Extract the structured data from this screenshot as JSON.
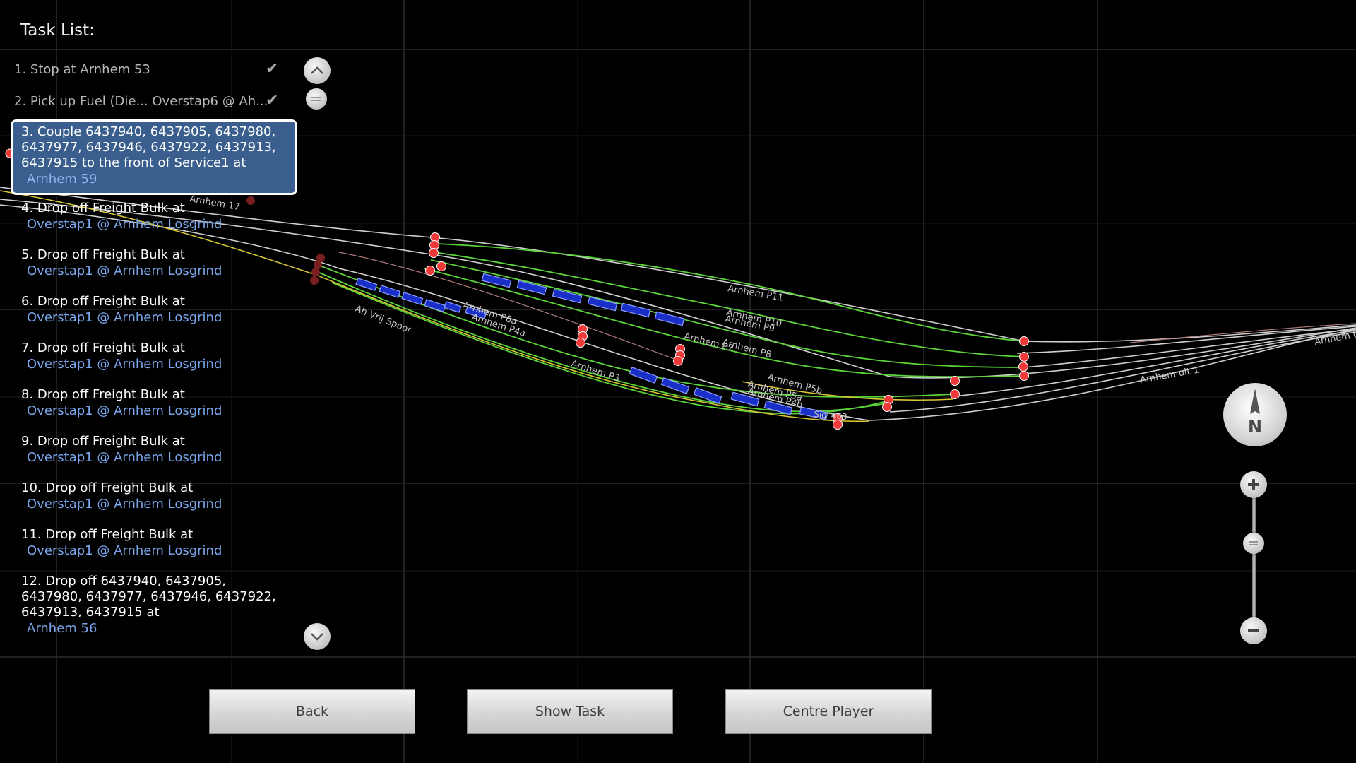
{
  "task_list": {
    "title": "Task List:",
    "items": [
      {
        "text": "1. Stop at  Arnhem 53",
        "location": "",
        "done": true
      },
      {
        "text": "2. Pick up Fuel (Die... Overstap6 @ Ah...",
        "location": "",
        "done": true
      },
      {
        "text": "3. Couple 6437940, 6437905, 6437980, 6437977, 6437946, 6437922, 6437913, 6437915 to the front of Service1 at",
        "location": "Arnhem 59",
        "selected": true
      },
      {
        "text": "4. Drop off Freight Bulk at",
        "location": "Overstap1 @ Arnhem Losgrind"
      },
      {
        "text": "5. Drop off Freight Bulk at",
        "location": "Overstap1 @ Arnhem Losgrind"
      },
      {
        "text": "6. Drop off Freight Bulk at",
        "location": "Overstap1 @ Arnhem Losgrind"
      },
      {
        "text": "7. Drop off Freight Bulk at",
        "location": "Overstap1 @ Arnhem Losgrind"
      },
      {
        "text": "8. Drop off Freight Bulk at",
        "location": "Overstap1 @ Arnhem Losgrind"
      },
      {
        "text": "9. Drop off Freight Bulk at",
        "location": "Overstap1 @ Arnhem Losgrind"
      },
      {
        "text": "10. Drop off Freight Bulk at",
        "location": "Overstap1 @ Arnhem Losgrind"
      },
      {
        "text": "11. Drop off Freight Bulk at",
        "location": "Overstap1 @ Arnhem Losgrind"
      },
      {
        "text": "12. Drop off 6437940, 6437905, 6437980, 6437977, 6437946, 6437922, 6437913, 6437915 at",
        "location": "Arnhem 56"
      }
    ]
  },
  "buttons": {
    "back": "Back",
    "show_task": "Show Task",
    "centre_player": "Centre Player"
  },
  "compass": {
    "label": "N"
  },
  "map": {
    "track_labels": {
      "p11": "Arnhem P11",
      "p10": "Arnhem P10",
      "p9": "Arnhem P9",
      "p8": "Arnhem P8",
      "p7": "Arnhem P7",
      "p6a": "Arnhem P6a",
      "p4a": "Arnhem P4a",
      "p3": "Arnhem P3",
      "p5b": "Arnhem P5b",
      "p5a": "Arnhem P5a",
      "p4b": "Arnhem P4b",
      "ah_vrij_spoor": "Ah Vrij Spoor",
      "arnhem_17": "Arnhem 17",
      "arnhem_uit_1": "Arnhem uit 1",
      "arnhem_edge": "Arnhem U",
      "signal_label": "Sig_463"
    },
    "colors": {
      "background": "#000000",
      "grid": "#2a2a2a",
      "track_white": "#cfcfcf",
      "track_green": "#5bd63a",
      "track_yellow": "#d9c636",
      "signal_red": "#f03a3a",
      "signal_dark": "#8b2020",
      "train_blue": "#1a2ec8",
      "selected_task_bg": "#3a5f8e",
      "location_text": "#79a6ec"
    }
  }
}
